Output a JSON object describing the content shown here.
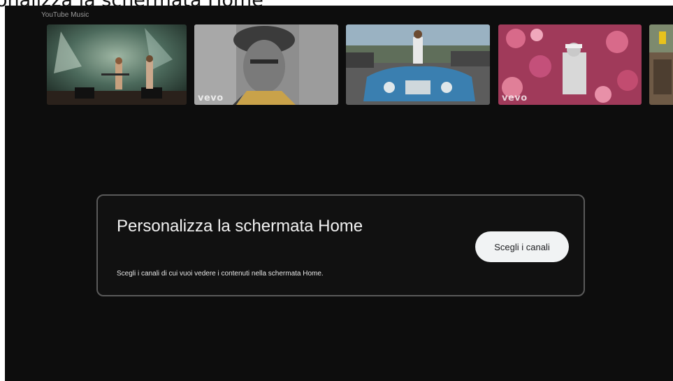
{
  "caption": "onalizza la schermata Home",
  "row": {
    "title": "YouTube Music",
    "thumbnails": [
      {
        "id": "concert",
        "badge": ""
      },
      {
        "id": "portrait-bandana",
        "badge": "vevo"
      },
      {
        "id": "blue-convertible",
        "badge": ""
      },
      {
        "id": "floral-wall",
        "badge": "vevo"
      },
      {
        "id": "partial-right",
        "badge": ""
      }
    ]
  },
  "card": {
    "title": "Personalizza la schermata Home",
    "subtitle": "Scegli i canali di cui vuoi vedere i contenuti nella schermata Home.",
    "button_label": "Scegli i canali"
  },
  "colors": {
    "background": "#0d0d0d",
    "card_border": "#5a5a5a",
    "button_bg": "#f1f3f4"
  }
}
